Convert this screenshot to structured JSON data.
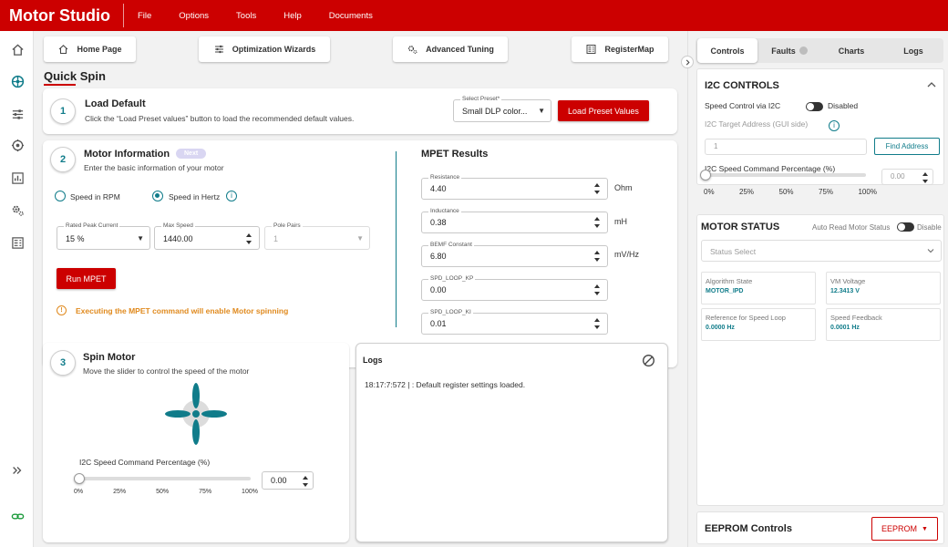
{
  "app": {
    "title": "Motor Studio",
    "menu": [
      "File",
      "Options",
      "Tools",
      "Help",
      "Documents"
    ]
  },
  "colors": {
    "brand": "#cc0000",
    "accent": "#107c8a"
  },
  "nav_icons": [
    "home-icon",
    "wizard-icon",
    "tuning-icon",
    "motor-icon",
    "chart-icon",
    "gear-icon",
    "register-icon",
    "expand-icon",
    "link-icon"
  ],
  "toolbar": {
    "home": "Home Page",
    "optimization": "Optimization Wizards",
    "advanced": "Advanced Tuning",
    "registermap": "RegisterMap"
  },
  "quick_spin": {
    "title": "Quick Spin"
  },
  "load_default": {
    "step": "1",
    "title": "Load Default",
    "description": "Click the “Load Preset values” button to load the recommended default values.",
    "preset_label": "Select Preset*",
    "preset_value": "Small DLP color...",
    "button": "Load Preset Values"
  },
  "motor_info": {
    "step": "2",
    "title": "Motor Information",
    "badge": "Next",
    "description": "Enter the basic information of your motor",
    "radio_rpm": "Speed in RPM",
    "radio_hertz": "Speed in Hertz",
    "rated_peak_current": {
      "label": "Rated Peak Current",
      "value": "15 %"
    },
    "max_speed": {
      "label": "Max Speed",
      "value": "1440.00"
    },
    "pole_pairs": {
      "label": "Pole Pairs",
      "value": "1"
    },
    "run_button": "Run MPET",
    "warning": "Executing the MPET command will enable Motor spinning"
  },
  "mpet": {
    "title": "MPET Results",
    "fields": [
      {
        "label": "Resistance",
        "value": "4.40",
        "unit": "Ohm"
      },
      {
        "label": "Inductance",
        "value": "0.38",
        "unit": "mH"
      },
      {
        "label": "BEMF Constant",
        "value": "6.80",
        "unit": "mV/Hz"
      },
      {
        "label": "SPD_LOOP_KP",
        "value": "0.00",
        "unit": ""
      },
      {
        "label": "SPD_LOOP_KI",
        "value": "0.01",
        "unit": ""
      }
    ]
  },
  "spin_motor": {
    "step": "3",
    "title": "Spin Motor",
    "description": "Move the slider to control the speed of the motor",
    "slider_label": "I2C Speed Command Percentage (%)",
    "slider_value": "0.00",
    "slider_fraction": 0,
    "ticks": [
      "0%",
      "25%",
      "50%",
      "75%",
      "100%"
    ]
  },
  "logs": {
    "title": "Logs",
    "entries": [
      "18:17:7:572 | : Default register settings loaded."
    ]
  },
  "right_tabs": [
    "Controls",
    "Faults",
    "Charts",
    "Logs"
  ],
  "i2c": {
    "title": "I2C CONTROLS",
    "speed_control_label": "Speed Control via I2C",
    "speed_control_state": "Disabled",
    "target_label": "I2C Target Address (GUI side)",
    "target_value": "1",
    "find_button": "Find Address",
    "speed_pct_label": "I2C Speed Command Percentage (%)",
    "speed_pct_value": "0.00",
    "ticks": [
      "0%",
      "25%",
      "50%",
      "75%",
      "100%"
    ]
  },
  "motor_status": {
    "title": "MOTOR STATUS",
    "auto_read_label": "Auto Read Motor Status",
    "auto_read_state": "Disable",
    "status_select": "Status Select",
    "items": [
      {
        "label": "Algorithm State",
        "value": "MOTOR_IPD"
      },
      {
        "label": "VM Voltage",
        "value": "12.3413 V"
      },
      {
        "label": "Reference for Speed Loop",
        "value": "0.0000 Hz"
      },
      {
        "label": "Speed Feedback",
        "value": "0.0001 Hz"
      }
    ]
  },
  "eeprom": {
    "title": "EEPROM Controls",
    "button": "EEPROM"
  }
}
